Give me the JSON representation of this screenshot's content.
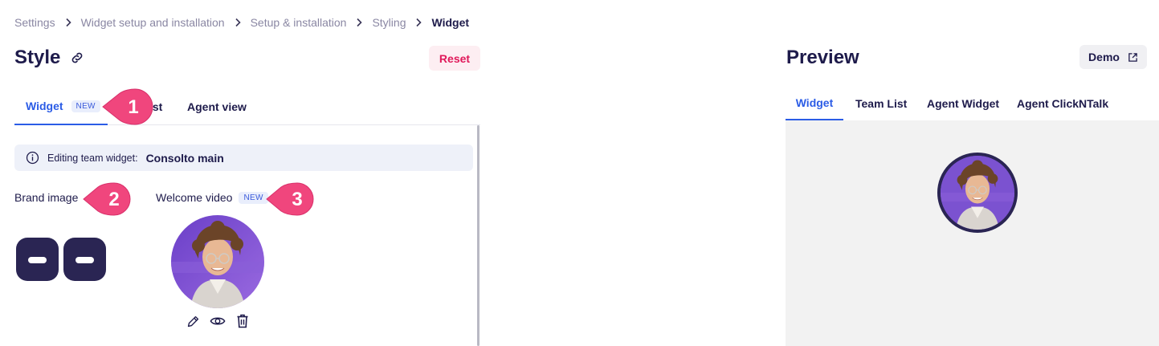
{
  "breadcrumb": {
    "items": [
      "Settings",
      "Widget setup and installation",
      "Setup & installation",
      "Styling",
      "Widget"
    ]
  },
  "header": {
    "title": "Style",
    "reset_label": "Reset"
  },
  "left_tabs": {
    "widget_label": "Widget",
    "widget_badge": "NEW",
    "team_list_label_visible": "ist",
    "agent_view_label": "Agent view"
  },
  "info": {
    "prefix": "Editing team widget:",
    "team_name": "Consolto main"
  },
  "brand": {
    "label": "Brand image"
  },
  "welcome": {
    "label": "Welcome video",
    "badge": "NEW"
  },
  "callouts": [
    "1",
    "2",
    "3"
  ],
  "preview": {
    "title": "Preview",
    "demo_label": "Demo",
    "tabs": [
      "Widget",
      "Team List",
      "Agent Widget",
      "Agent ClickNTalk"
    ]
  },
  "colors": {
    "accent": "#2b5ce6",
    "reset_text": "#e0195a",
    "callout": "#f0467d",
    "brand": "#2a2553"
  },
  "icons": [
    "chevron-right-icon",
    "link-icon",
    "info-icon",
    "pencil-icon",
    "eye-icon",
    "trash-icon",
    "external-link-icon"
  ]
}
